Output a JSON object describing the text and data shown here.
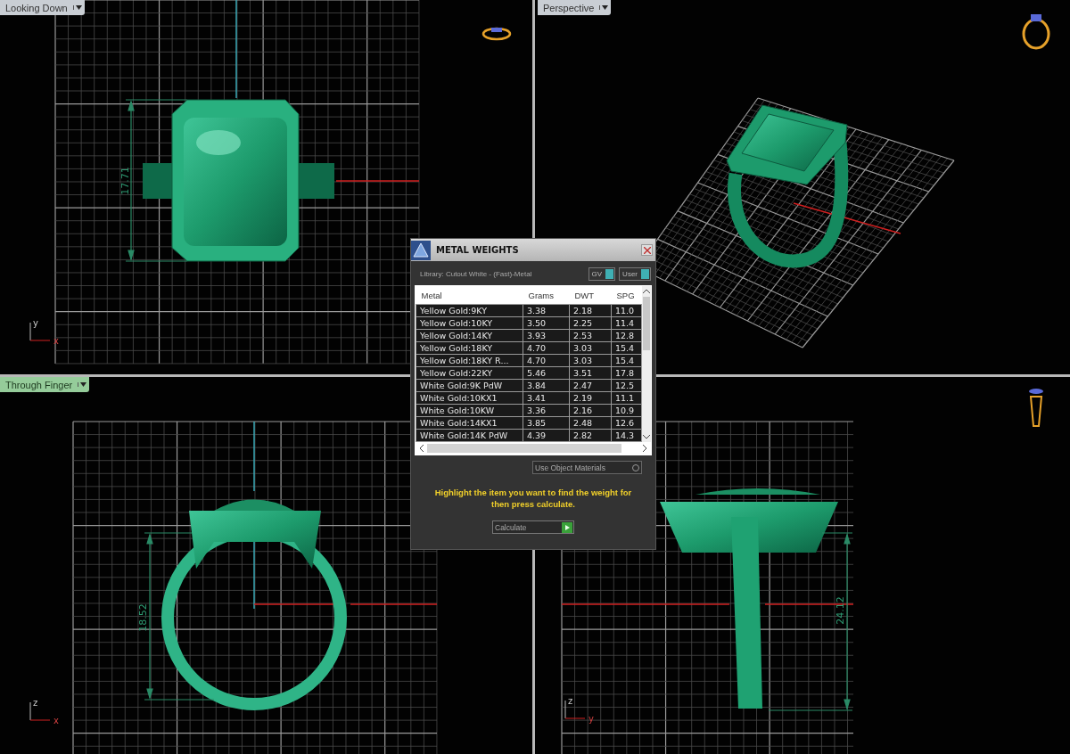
{
  "viewports": [
    {
      "kind": "top",
      "label": "Looking Down",
      "selected": false,
      "dimension": "17.71",
      "axes": [
        "y",
        "x"
      ]
    },
    {
      "kind": "perspective",
      "label": "Perspective",
      "selected": false
    },
    {
      "kind": "front",
      "label": "Through Finger",
      "selected": true,
      "dimension": "18.52",
      "axes": [
        "z",
        "x"
      ]
    },
    {
      "kind": "side",
      "dimension": "24.12",
      "axes": [
        "z",
        "y"
      ]
    }
  ],
  "dialog": {
    "title": "METAL WEIGHTS",
    "library": "Library: Cutout White - (Fast)-Metal",
    "toggles": [
      {
        "label": "GV",
        "on": true
      },
      {
        "label": "User",
        "on": true
      }
    ],
    "table": {
      "columns": [
        "Metal",
        "Grams",
        "DWT",
        "SPG"
      ],
      "rows": [
        [
          "Yellow Gold:9KY",
          "3.38",
          "2.18",
          "11.0"
        ],
        [
          "Yellow Gold:10KY",
          "3.50",
          "2.25",
          "11.4"
        ],
        [
          "Yellow Gold:14KY",
          "3.93",
          "2.53",
          "12.8"
        ],
        [
          "Yellow Gold:18KY",
          "4.70",
          "3.03",
          "15.4"
        ],
        [
          "Yellow Gold:18KY R...",
          "4.70",
          "3.03",
          "15.4"
        ],
        [
          "Yellow Gold:22KY",
          "5.46",
          "3.51",
          "17.8"
        ],
        [
          "White Gold:9K PdW",
          "3.84",
          "2.47",
          "12.5"
        ],
        [
          "White Gold:10KX1",
          "3.41",
          "2.19",
          "11.1"
        ],
        [
          "White Gold:10KW",
          "3.36",
          "2.16",
          "10.9"
        ],
        [
          "White Gold:14KX1",
          "3.85",
          "2.48",
          "12.6"
        ],
        [
          "White Gold:14K PdW",
          "4.39",
          "2.82",
          "14.3"
        ]
      ]
    },
    "materials_dropdown": "Use Object Materials",
    "instruction": "Highlight the item you want to find the weight for then press calculate.",
    "calculate_button": "Calculate"
  }
}
